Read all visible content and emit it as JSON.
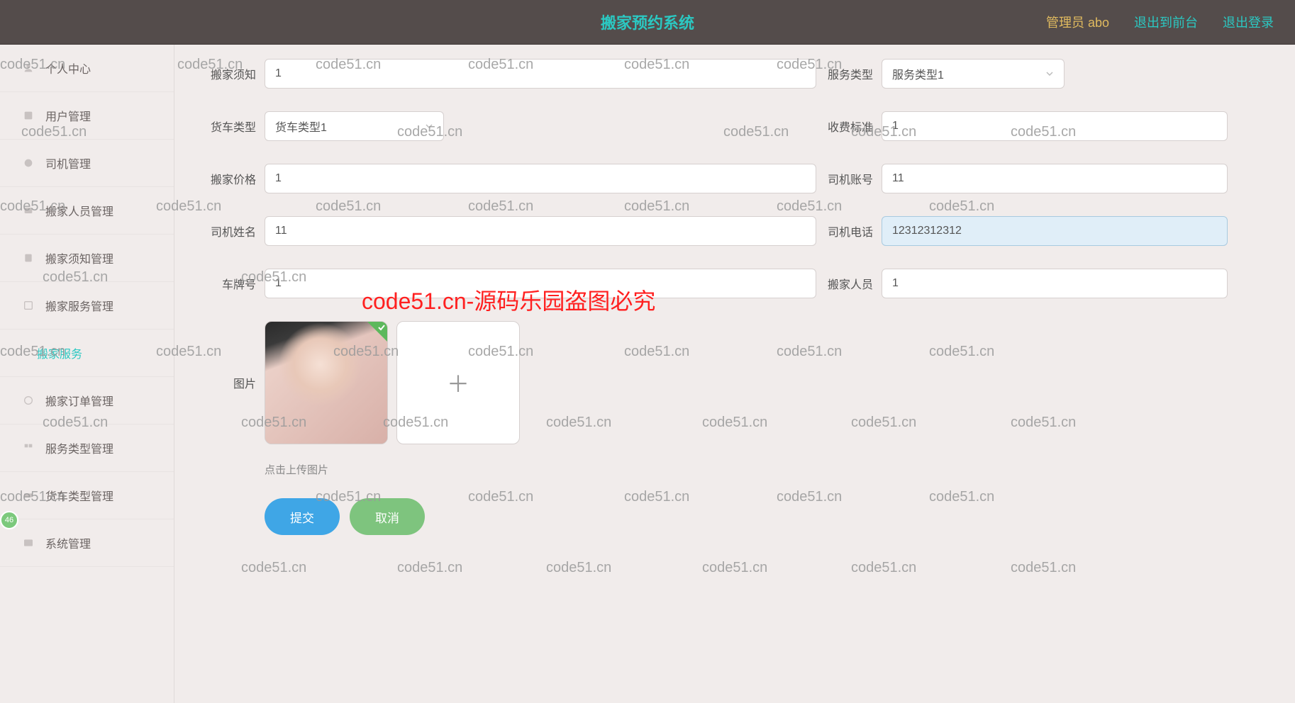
{
  "header": {
    "title": "搬家预约系统",
    "admin_label": "管理员 abo",
    "link_front": "退出到前台",
    "link_logout": "退出登录"
  },
  "sidebar": {
    "items": [
      {
        "label": "个人中心",
        "icon": "user"
      },
      {
        "label": "用户管理",
        "icon": "users"
      },
      {
        "label": "司机管理",
        "icon": "driver"
      },
      {
        "label": "搬家人员管理",
        "icon": "worker"
      },
      {
        "label": "搬家须知管理",
        "icon": "notice"
      },
      {
        "label": "搬家服务管理",
        "icon": "service"
      },
      {
        "label": "搬家服务",
        "icon": "",
        "active": true
      },
      {
        "label": "搬家订单管理",
        "icon": "order"
      },
      {
        "label": "服务类型管理",
        "icon": "type"
      },
      {
        "label": "货车类型管理",
        "icon": "truck"
      },
      {
        "label": "系统管理",
        "icon": "system"
      }
    ]
  },
  "form": {
    "notice_label": "搬家须知",
    "notice_value": "1",
    "service_type_label": "服务类型",
    "service_type_value": "服务类型1",
    "truck_type_label": "货车类型",
    "truck_type_value": "货车类型1",
    "fee_label": "收费标准",
    "fee_value": "1",
    "price_label": "搬家价格",
    "price_value": "1",
    "driver_account_label": "司机账号",
    "driver_account_value": "11",
    "driver_name_label": "司机姓名",
    "driver_name_value": "11",
    "driver_phone_label": "司机电话",
    "driver_phone_value": "12312312312",
    "plate_label": "车牌号",
    "plate_value": "1",
    "staff_label": "搬家人员",
    "staff_value": "1",
    "image_label": "图片",
    "hint": "点击上传图片",
    "submit": "提交",
    "cancel": "取消"
  },
  "watermark": {
    "text": "code51.cn",
    "big_text": "code51.cn-源码乐园盗图必究"
  },
  "badge": "46"
}
